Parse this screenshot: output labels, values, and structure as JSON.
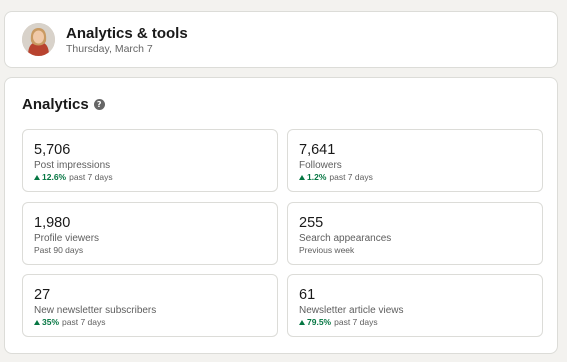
{
  "header": {
    "title": "Analytics & tools",
    "date": "Thursday, March 7",
    "avatar_icon": "profile-photo"
  },
  "analytics": {
    "title": "Analytics",
    "help_icon": "question-circle-icon",
    "tiles": [
      {
        "value": "5,706",
        "label": "Post impressions",
        "trend": "12.6%",
        "period": "past 7 days"
      },
      {
        "value": "7,641",
        "label": "Followers",
        "trend": "1.2%",
        "period": "past 7 days"
      },
      {
        "value": "1,980",
        "label": "Profile viewers",
        "trend": "",
        "period": "Past 90 days"
      },
      {
        "value": "255",
        "label": "Search appearances",
        "trend": "",
        "period": "Previous week"
      },
      {
        "value": "27",
        "label": "New newsletter subscribers",
        "trend": "35%",
        "period": "past 7 days"
      },
      {
        "value": "61",
        "label": "Newsletter article views",
        "trend": "79.5%",
        "period": "past 7 days"
      }
    ]
  },
  "colors": {
    "trend_up": "#057642",
    "background": "#f3f2ef"
  }
}
